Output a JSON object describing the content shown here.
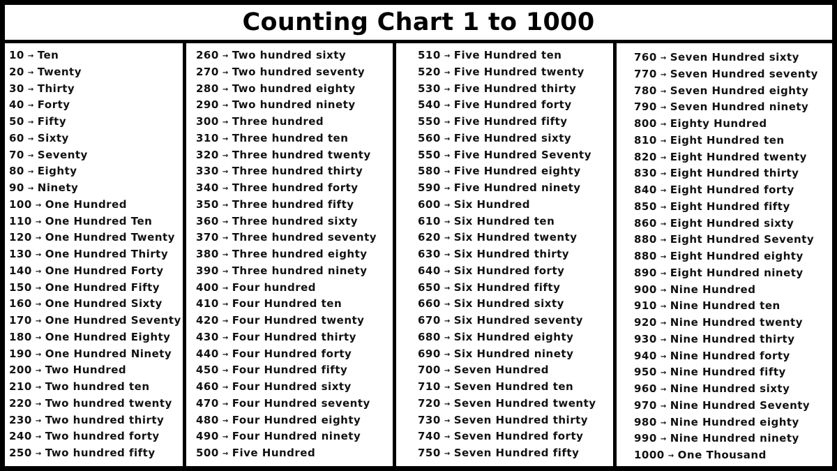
{
  "title": "Counting Chart 1 to 1000",
  "arrow_icon": "→",
  "columns": [
    {
      "rows": [
        {
          "number": "10",
          "word": "Ten"
        },
        {
          "number": "20",
          "word": "Twenty"
        },
        {
          "number": "30",
          "word": "Thirty"
        },
        {
          "number": "40",
          "word": "Forty"
        },
        {
          "number": "50",
          "word": "Fifty"
        },
        {
          "number": "60",
          "word": "Sixty"
        },
        {
          "number": "70",
          "word": "Seventy"
        },
        {
          "number": "80",
          "word": "Eighty"
        },
        {
          "number": "90",
          "word": "Ninety"
        },
        {
          "number": "100",
          "word": "One Hundred"
        },
        {
          "number": "110",
          "word": "One Hundred Ten"
        },
        {
          "number": "120",
          "word": "One Hundred Twenty"
        },
        {
          "number": "130",
          "word": "One Hundred Thirty"
        },
        {
          "number": "140",
          "word": "One Hundred Forty"
        },
        {
          "number": "150",
          "word": "One Hundred Fifty"
        },
        {
          "number": "160",
          "word": "One Hundred Sixty"
        },
        {
          "number": "170",
          "word": "One Hundred Seventy"
        },
        {
          "number": "180",
          "word": "One Hundred Eighty"
        },
        {
          "number": "190",
          "word": "One Hundred Ninety"
        },
        {
          "number": "200",
          "word": "Two Hundred"
        },
        {
          "number": "210",
          "word": "Two hundred ten"
        },
        {
          "number": "220",
          "word": "Two hundred twenty"
        },
        {
          "number": "230",
          "word": "Two hundred thirty"
        },
        {
          "number": "240",
          "word": "Two hundred forty"
        },
        {
          "number": "250",
          "word": "Two hundred fifty"
        }
      ]
    },
    {
      "rows": [
        {
          "number": "260",
          "word": "Two hundred sixty"
        },
        {
          "number": "270",
          "word": "Two hundred seventy"
        },
        {
          "number": "280",
          "word": "Two hundred eighty"
        },
        {
          "number": "290",
          "word": "Two hundred ninety"
        },
        {
          "number": "300",
          "word": "Three hundred"
        },
        {
          "number": "310",
          "word": "Three hundred ten"
        },
        {
          "number": "320",
          "word": "Three hundred twenty"
        },
        {
          "number": "330",
          "word": "Three hundred thirty"
        },
        {
          "number": "340",
          "word": "Three hundred forty"
        },
        {
          "number": "350",
          "word": "Three hundred fifty"
        },
        {
          "number": "360",
          "word": "Three hundred sixty"
        },
        {
          "number": "370",
          "word": "Three hundred seventy"
        },
        {
          "number": "380",
          "word": "Three hundred eighty"
        },
        {
          "number": "390",
          "word": "Three hundred ninety"
        },
        {
          "number": "400",
          "word": "Four hundred"
        },
        {
          "number": "410",
          "word": "Four Hundred ten"
        },
        {
          "number": "420",
          "word": "Four Hundred twenty"
        },
        {
          "number": "430",
          "word": "Four Hundred thirty"
        },
        {
          "number": "440",
          "word": "Four Hundred forty"
        },
        {
          "number": "450",
          "word": "Four Hundred fifty"
        },
        {
          "number": "460",
          "word": "Four Hundred sixty"
        },
        {
          "number": "470",
          "word": "Four Hundred seventy"
        },
        {
          "number": "480",
          "word": "Four Hundred eighty"
        },
        {
          "number": "490",
          "word": "Four Hundred ninety"
        },
        {
          "number": "500",
          "word": "Five Hundred"
        }
      ]
    },
    {
      "rows": [
        {
          "number": "510",
          "word": "Five Hundred ten"
        },
        {
          "number": "520",
          "word": "Five Hundred twenty"
        },
        {
          "number": "530",
          "word": "Five Hundred thirty"
        },
        {
          "number": "540",
          "word": "Five Hundred forty"
        },
        {
          "number": "550",
          "word": "Five Hundred fifty"
        },
        {
          "number": "560",
          "word": "Five Hundred sixty"
        },
        {
          "number": "550",
          "word": "Five Hundred Seventy"
        },
        {
          "number": "580",
          "word": "Five Hundred eighty"
        },
        {
          "number": "590",
          "word": "Five Hundred ninety"
        },
        {
          "number": "600",
          "word": "Six Hundred"
        },
        {
          "number": "610",
          "word": "Six Hundred ten"
        },
        {
          "number": "620",
          "word": "Six Hundred twenty"
        },
        {
          "number": "630",
          "word": "Six Hundred thirty"
        },
        {
          "number": "640",
          "word": "Six Hundred forty"
        },
        {
          "number": "650",
          "word": "Six Hundred fifty"
        },
        {
          "number": "660",
          "word": "Six Hundred sixty"
        },
        {
          "number": "670",
          "word": "Six Hundred seventy"
        },
        {
          "number": "680",
          "word": "Six Hundred eighty"
        },
        {
          "number": "690",
          "word": "Six Hundred ninety"
        },
        {
          "number": "700",
          "word": "Seven Hundred"
        },
        {
          "number": "710",
          "word": "Seven Hundred ten"
        },
        {
          "number": "720",
          "word": "Seven Hundred twenty"
        },
        {
          "number": "730",
          "word": "Seven Hundred thirty"
        },
        {
          "number": "740",
          "word": "Seven Hundred forty"
        },
        {
          "number": "750",
          "word": "Seven Hundred fifty"
        }
      ]
    },
    {
      "rows": [
        {
          "number": "760",
          "word": "Seven Hundred sixty"
        },
        {
          "number": "770",
          "word": "Seven Hundred seventy"
        },
        {
          "number": "780",
          "word": "Seven Hundred eighty"
        },
        {
          "number": "790",
          "word": "Seven Hundred ninety"
        },
        {
          "number": "800",
          "word": "Eighty Hundred"
        },
        {
          "number": "810",
          "word": "Eight Hundred ten"
        },
        {
          "number": "820",
          "word": "Eight Hundred twenty"
        },
        {
          "number": "830",
          "word": "Eight Hundred thirty"
        },
        {
          "number": "840",
          "word": "Eight Hundred forty"
        },
        {
          "number": "850",
          "word": "Eight Hundred fifty"
        },
        {
          "number": "860",
          "word": "Eight Hundred sixty"
        },
        {
          "number": "880",
          "word": "Eight Hundred Seventy"
        },
        {
          "number": "880",
          "word": "Eight Hundred eighty"
        },
        {
          "number": "890",
          "word": "Eight Hundred ninety"
        },
        {
          "number": "900",
          "word": "Nine Hundred"
        },
        {
          "number": "910",
          "word": "Nine Hundred ten"
        },
        {
          "number": "920",
          "word": "Nine Hundred twenty"
        },
        {
          "number": "930",
          "word": "Nine Hundred thirty"
        },
        {
          "number": "940",
          "word": "Nine Hundred forty"
        },
        {
          "number": "950",
          "word": "Nine Hundred fifty"
        },
        {
          "number": "960",
          "word": "Nine Hundred sixty"
        },
        {
          "number": "970",
          "word": "Nine Hundred Seventy"
        },
        {
          "number": "980",
          "word": "Nine Hundred eighty"
        },
        {
          "number": "990",
          "word": "Nine Hundred ninety"
        },
        {
          "number": "1000",
          "word": "One Thousand"
        }
      ]
    }
  ]
}
